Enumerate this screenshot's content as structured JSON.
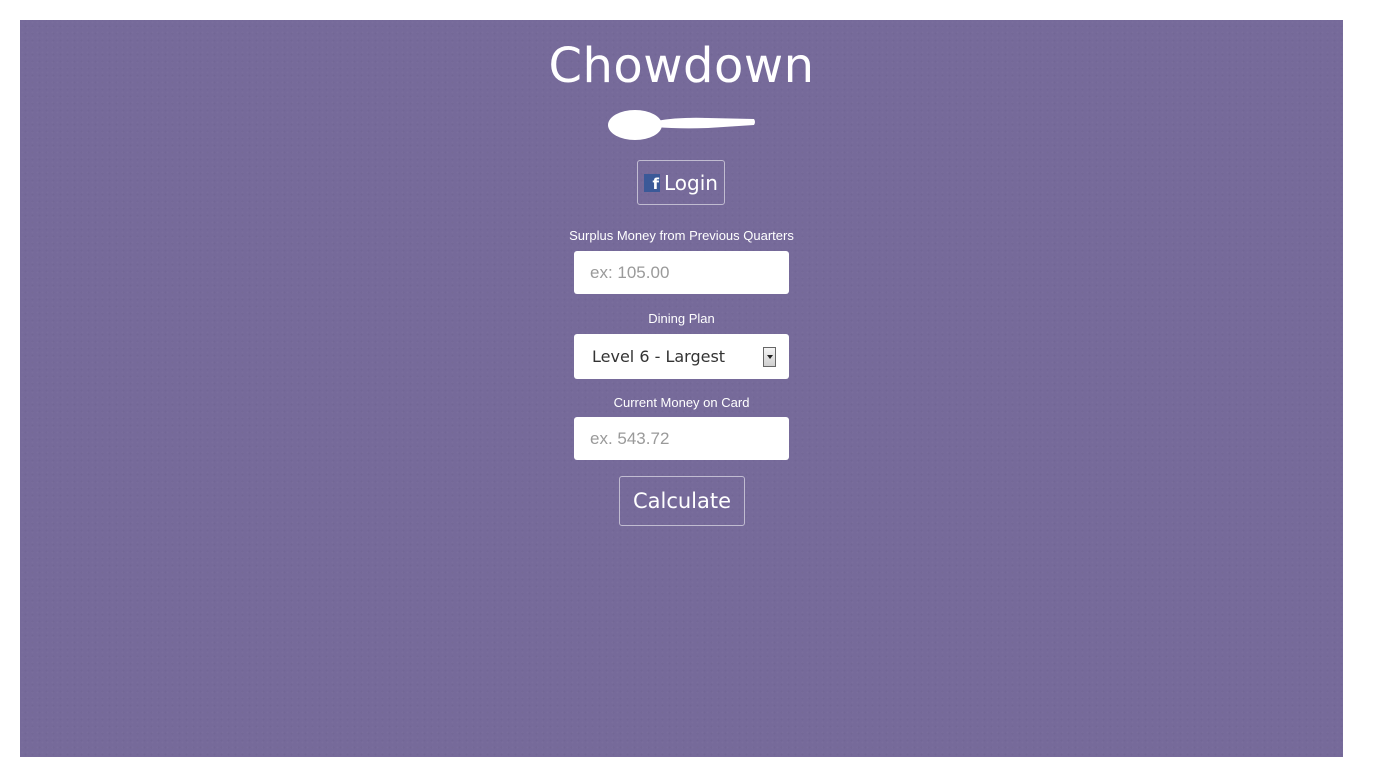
{
  "app": {
    "title": "Chowdown",
    "logo_icon": "spoon-icon"
  },
  "login": {
    "icon": "facebook-icon",
    "icon_glyph": "f",
    "label": "Login",
    "icon_color": "#3b5998"
  },
  "form": {
    "surplus": {
      "label": "Surplus Money from Previous Quarters",
      "placeholder": "ex: 105.00",
      "value": ""
    },
    "dining_plan": {
      "label": "Dining Plan",
      "selected": "Level 6 - Largest"
    },
    "current_money": {
      "label": "Current Money on Card",
      "placeholder": "ex. 543.72",
      "value": ""
    },
    "calculate_label": "Calculate"
  },
  "colors": {
    "background": "#766a9a",
    "text": "#ffffff"
  }
}
